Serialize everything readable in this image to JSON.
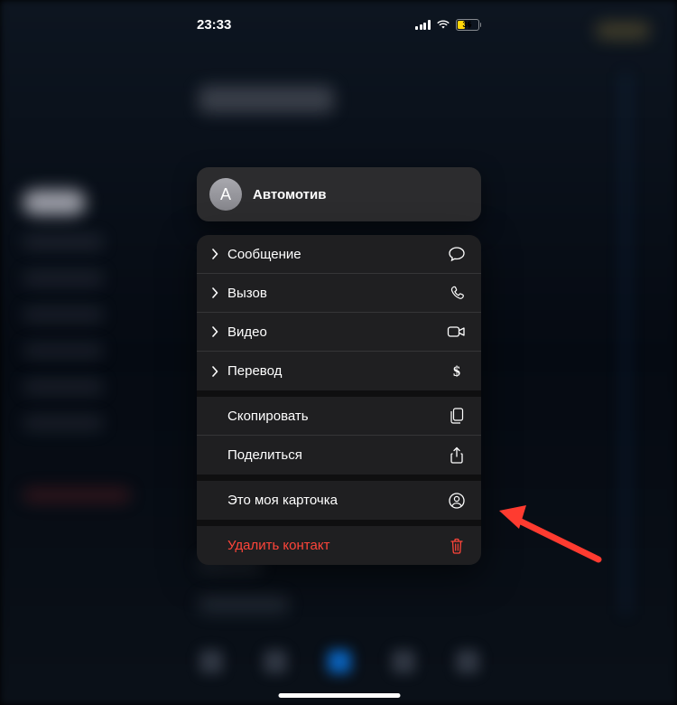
{
  "status": {
    "time": "23:33",
    "battery_text": "36",
    "battery_percent": 36
  },
  "contact": {
    "avatar_initial": "А",
    "name": "Автомотив"
  },
  "menu": {
    "primary": [
      {
        "label": "Сообщение",
        "icon": "message-icon"
      },
      {
        "label": "Вызов",
        "icon": "phone-icon"
      },
      {
        "label": "Видео",
        "icon": "video-icon"
      },
      {
        "label": "Перевод",
        "icon": "dollar-icon"
      }
    ],
    "secondary": [
      {
        "label": "Скопировать",
        "icon": "copy-icon"
      },
      {
        "label": "Поделиться",
        "icon": "share-icon"
      }
    ],
    "tertiary": [
      {
        "label": "Это моя карточка",
        "icon": "person-circle-icon"
      }
    ],
    "destructive": {
      "label": "Удалить контакт",
      "icon": "trash-icon"
    }
  },
  "colors": {
    "destructive": "#ff453a",
    "card_bg": "#2c2c2e",
    "menu_bg": "#1f1f21",
    "battery_fill": "#ffd60a"
  }
}
